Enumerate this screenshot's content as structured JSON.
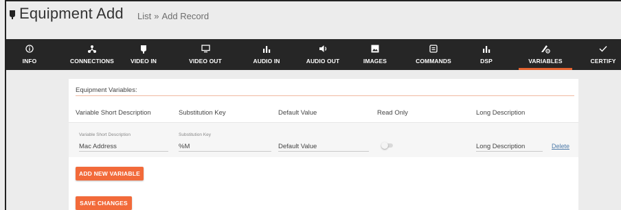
{
  "header": {
    "title": "Equipment Add",
    "breadcrumb": {
      "list": "List",
      "separator": "»",
      "current": "Add Record"
    }
  },
  "nav": {
    "items": [
      {
        "label": "INFO",
        "icon": "info-icon"
      },
      {
        "label": "CONNECTIONS",
        "icon": "connections-icon"
      },
      {
        "label": "VIDEO IN",
        "icon": "video-in-icon"
      },
      {
        "label": "VIDEO OUT",
        "icon": "monitor-icon"
      },
      {
        "label": "AUDIO IN",
        "icon": "bars-icon"
      },
      {
        "label": "AUDIO OUT",
        "icon": "speaker-icon"
      },
      {
        "label": "IMAGES",
        "icon": "image-icon"
      },
      {
        "label": "COMMANDS",
        "icon": "commands-icon"
      },
      {
        "label": "DSP",
        "icon": "bars-icon"
      },
      {
        "label": "VARIABLES",
        "icon": "variables-icon"
      },
      {
        "label": "CERTIFY",
        "icon": "check-icon"
      }
    ],
    "active": "VARIABLES",
    "accent_color": "#e4632f",
    "background": "#262626"
  },
  "variables": {
    "section_title": "Equipment Variables:",
    "columns": [
      "Variable Short Description",
      "Substitution Key",
      "Default Value",
      "Read Only",
      "Long Description"
    ],
    "rows": [
      {
        "short_description_label": "Variable Short Description",
        "short_description": "Mac Address",
        "substitution_key_label": "Substitution Key",
        "substitution_key": "%M",
        "default_value_placeholder": "Default Value",
        "read_only": false,
        "long_description_placeholder": "Long Description",
        "delete_label": "Delete"
      }
    ]
  },
  "actions": {
    "add_variable": "ADD NEW VARIABLE",
    "save_changes": "SAVE CHANGES",
    "button_color": "#f26a3a"
  }
}
